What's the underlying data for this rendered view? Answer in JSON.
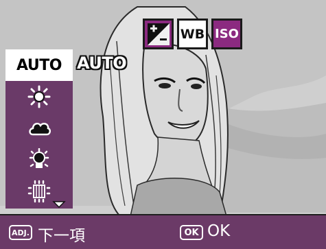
{
  "tabs": [
    {
      "name": "exposure-compensation",
      "icon": "exposure-compensation-icon",
      "selected": false
    },
    {
      "name": "white-balance",
      "label": "WB",
      "selected": true
    },
    {
      "name": "iso",
      "label": "ISO",
      "selected": false
    }
  ],
  "menu": {
    "items": [
      {
        "label": "AUTO",
        "icon": "auto-text",
        "selected": true
      },
      {
        "icon": "sun-icon"
      },
      {
        "icon": "cloud-icon"
      },
      {
        "icon": "incandescent-bulb-icon"
      },
      {
        "icon": "fluorescent-lamp-icon"
      }
    ],
    "scroll_icon": "scroll-down-arrow-icon"
  },
  "current_value": "AUTO",
  "bottom": {
    "adj_icon": "ADJ.",
    "adj_label": "下一項",
    "ok_icon": "OK",
    "ok_label": "OK"
  },
  "colors": {
    "accent": "#8b2a80",
    "menu_bg": "#6a3a68",
    "bar_bg": "#6b3a67",
    "selected_bg": "#ffffff"
  }
}
